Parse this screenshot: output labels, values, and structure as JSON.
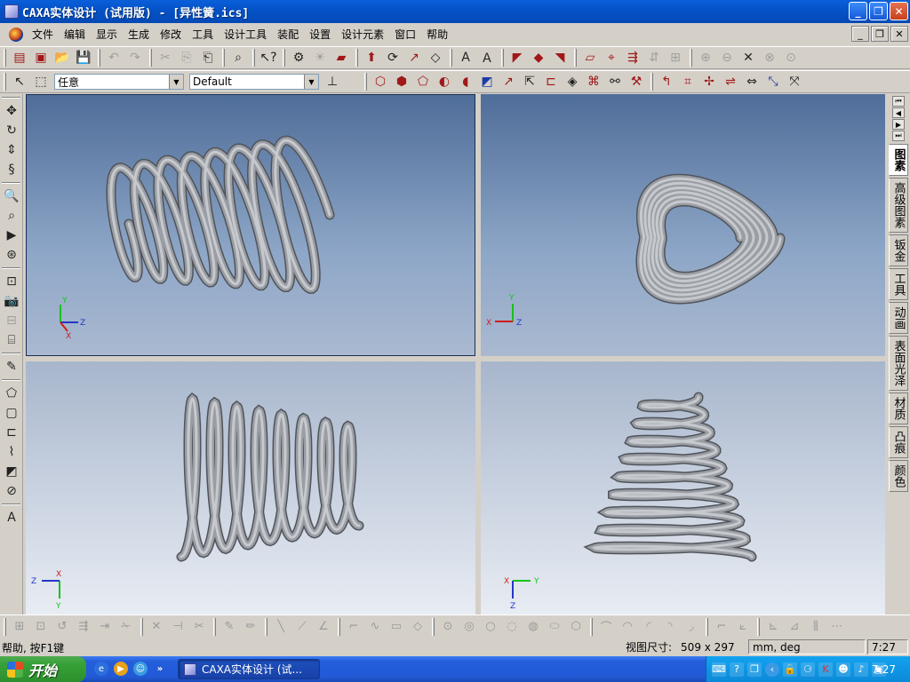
{
  "window": {
    "title": "CAXA实体设计 (试用版) - [异性簧.ics]",
    "minimize": "_",
    "restore": "❐",
    "close": "✕"
  },
  "menu": [
    {
      "label": "文件"
    },
    {
      "label": "编辑"
    },
    {
      "label": "显示"
    },
    {
      "label": "生成"
    },
    {
      "label": "修改"
    },
    {
      "label": "工具"
    },
    {
      "label": "设计工具"
    },
    {
      "label": "装配"
    },
    {
      "label": "设置"
    },
    {
      "label": "设计元素"
    },
    {
      "label": "窗口"
    },
    {
      "label": "帮助"
    }
  ],
  "toolbar2": {
    "filter_value": "任意",
    "style_value": "Default",
    "dropdown_arrow": "▼"
  },
  "viewports": [
    {
      "axes": {
        "a": "Y",
        "b": "Z",
        "c": "X"
      }
    },
    {
      "axes": {
        "a": "Y",
        "b": "Z",
        "c": "X"
      }
    },
    {
      "axes": {
        "a": "X",
        "b": "Z",
        "c": "Y"
      }
    },
    {
      "axes": {
        "a": "Y",
        "b": "X",
        "c": "Z"
      }
    }
  ],
  "right_tabs": [
    {
      "label": "图素"
    },
    {
      "label": "高级图素"
    },
    {
      "label": "钣金"
    },
    {
      "label": "工具"
    },
    {
      "label": "动画"
    },
    {
      "label": "表面光泽"
    },
    {
      "label": "材质"
    },
    {
      "label": "凸痕"
    },
    {
      "label": "颜色"
    }
  ],
  "status": {
    "help_text": "帮助, 按F1键",
    "view_size_label": "视图尺寸:",
    "view_size_value": "509 x  297",
    "units": "mm, deg",
    "time": "7:27"
  },
  "taskbar": {
    "start_label": "开始",
    "task_label": "CAXA实体设计 (试...",
    "clock": "7:27",
    "more": "»"
  },
  "colors": {
    "titlebar": "#0553c9",
    "viewport_top": "#4f6d99",
    "viewport_bottom": "#cfd7e4",
    "spring": "#9a9ea4"
  }
}
